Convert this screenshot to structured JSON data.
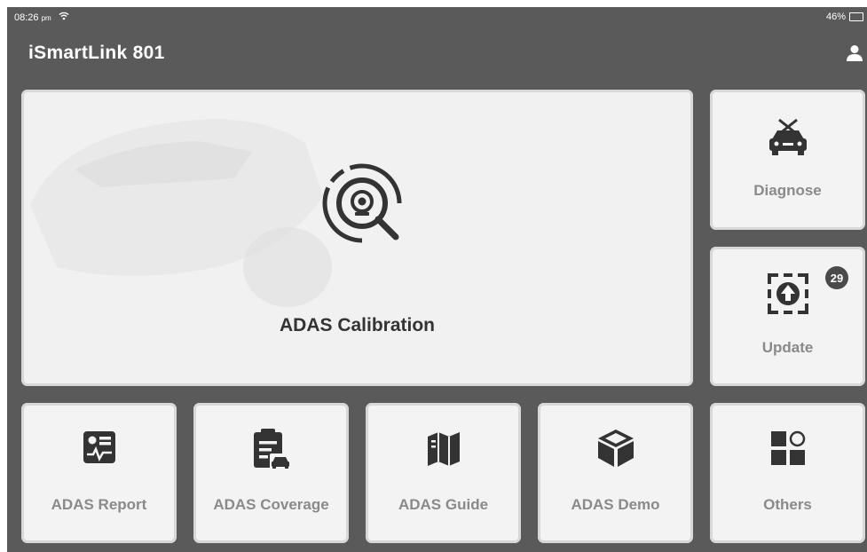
{
  "status_bar": {
    "time": "08:26",
    "ampm": "pm",
    "battery": "46%"
  },
  "header": {
    "title": "iSmartLink 801"
  },
  "main_tile": {
    "label": "ADAS Calibration",
    "icon": "search-camera-icon"
  },
  "side_tiles": [
    {
      "label": "Diagnose",
      "icon": "car-repair-icon"
    },
    {
      "label": "Update",
      "icon": "upload-icon",
      "badge": "29"
    }
  ],
  "bottom_tiles": [
    {
      "label": "ADAS Report",
      "icon": "report-icon"
    },
    {
      "label": "ADAS Coverage",
      "icon": "clipboard-car-icon"
    },
    {
      "label": "ADAS Guide",
      "icon": "map-icon"
    },
    {
      "label": "ADAS Demo",
      "icon": "cube-icon"
    },
    {
      "label": "Others",
      "icon": "grid-icon"
    }
  ],
  "colors": {
    "background": "#5a5a5a",
    "tile": "#f3f3f3",
    "icon": "#333333",
    "label": "#8a8a8a"
  }
}
